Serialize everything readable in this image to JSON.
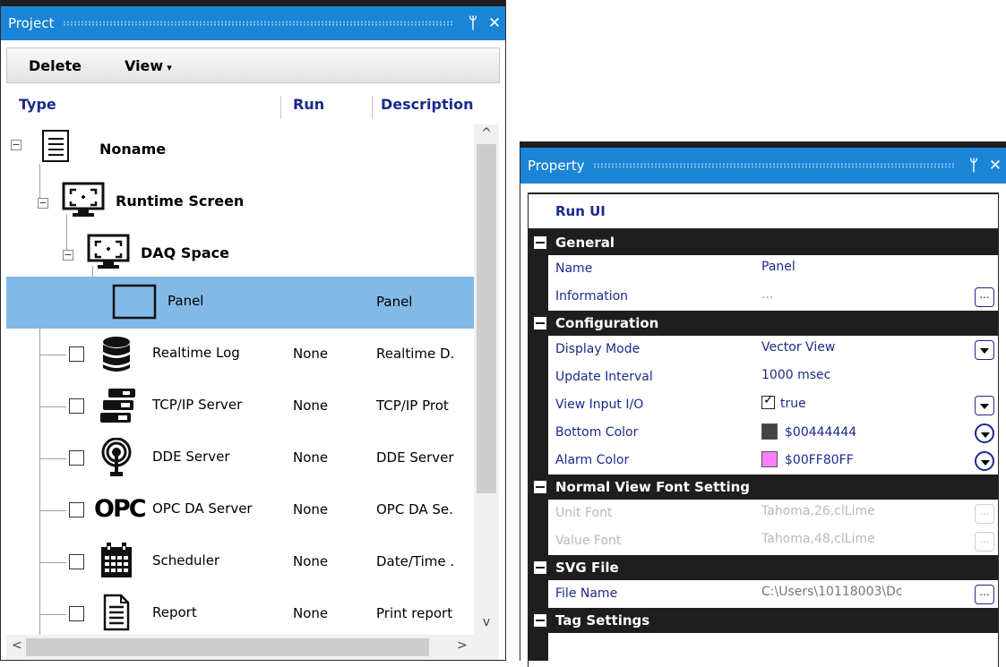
{
  "project": {
    "title": "Project",
    "pin_glyph": "ᛘ",
    "close_glyph": "✕",
    "toolbar": {
      "delete_label": "Delete",
      "view_label": "View",
      "view_caret": "▾"
    },
    "columns": {
      "type": "Type",
      "run": "Run",
      "description": "Description"
    },
    "tree": [
      {
        "label": "Noname",
        "icon": "document-icon",
        "run": "",
        "description": ""
      },
      {
        "label": "Runtime Screen",
        "icon": "monitor-icon",
        "run": "",
        "description": ""
      },
      {
        "label": "DAQ Space",
        "icon": "monitor-icon",
        "run": "",
        "description": ""
      },
      {
        "label": "Panel",
        "icon": "panel-rectangle-icon",
        "run": "",
        "description": "Panel"
      },
      {
        "label": "Realtime Log",
        "icon": "database-icon",
        "run": "None",
        "description": "Realtime D."
      },
      {
        "label": "TCP/IP Server",
        "icon": "server-icon",
        "run": "None",
        "description": "TCP/IP Prot"
      },
      {
        "label": "DDE Server",
        "icon": "broadcast-icon",
        "run": "None",
        "description": "DDE Server"
      },
      {
        "label": "OPC DA Server",
        "icon": "opc-logo-icon",
        "icon_text": "OPC",
        "run": "None",
        "description": "OPC DA Se."
      },
      {
        "label": "Scheduler",
        "icon": "calendar-icon",
        "run": "None",
        "description": "Date/Time ."
      },
      {
        "label": "Report",
        "icon": "report-document-icon",
        "run": "None",
        "description": "Print report"
      }
    ],
    "scroll": {
      "up": "^",
      "down": "v",
      "left": "<",
      "right": ">"
    }
  },
  "property": {
    "title": "Property",
    "pin_glyph": "ᛘ",
    "close_glyph": "✕",
    "object_title": "Run UI",
    "categories": [
      {
        "name": "General",
        "rows": [
          {
            "name": "Name",
            "value": "Panel"
          },
          {
            "name": "Information",
            "value": "...",
            "button": "..."
          }
        ]
      },
      {
        "name": "Configuration",
        "rows": [
          {
            "name": "Display Mode",
            "value": "Vector View"
          },
          {
            "name": "Update Interval",
            "value": "1000 msec"
          },
          {
            "name": "View Input I/O",
            "value": "true"
          },
          {
            "name": "Bottom Color",
            "value": "$00444444",
            "swatch": "#444444"
          },
          {
            "name": "Alarm Color",
            "value": "$00FF80FF",
            "swatch": "#FF80FF"
          }
        ]
      },
      {
        "name": "Normal View Font Setting",
        "rows": [
          {
            "name": "Unit Font",
            "value": "Tahoma,26,clLime",
            "button": "..."
          },
          {
            "name": "Value Font",
            "value": "Tahoma,48,clLime",
            "button": "..."
          }
        ]
      },
      {
        "name": "SVG File",
        "rows": [
          {
            "name": "File Name",
            "value": "C:\\Users\\10118003\\Dc",
            "button": "..."
          }
        ]
      },
      {
        "name": "Tag Settings",
        "rows": []
      }
    ]
  },
  "colors": {
    "title_bar": "#1a84d6",
    "selected_row": "#83b9e6",
    "category_bar": "#1e1e1e",
    "text_blue": "#1b2a8a"
  }
}
